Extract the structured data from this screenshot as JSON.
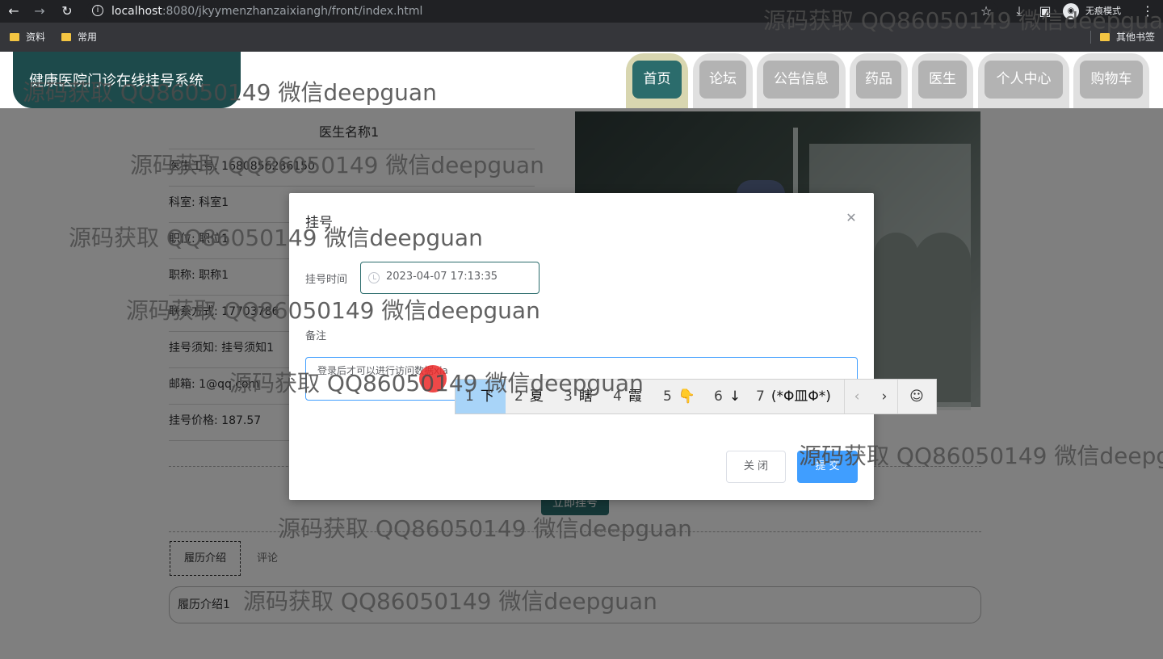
{
  "browser": {
    "url_host": "localhost",
    "url_path": ":8080/jkyymenzhanzaixiangh/front/index.html",
    "incognito_label": "无痕模式",
    "bookmarks": [
      "资料",
      "常用"
    ],
    "other_bookmarks": "其他书签"
  },
  "site": {
    "title": "健康医院门诊在线挂号系统",
    "nav": [
      {
        "label": "首页",
        "active": true
      },
      {
        "label": "论坛",
        "active": false
      },
      {
        "label": "公告信息",
        "active": false
      },
      {
        "label": "药品",
        "active": false
      },
      {
        "label": "医生",
        "active": false
      },
      {
        "label": "个人中心",
        "active": false
      },
      {
        "label": "购物车",
        "active": false
      }
    ]
  },
  "doctor": {
    "name": "医生名称1",
    "fields": [
      "医生工号: 1680856286150",
      "科室: 科室1",
      "职位: 职位1",
      "职称: 职称1",
      "联系方式: 17703786",
      "挂号须知: 挂号须知1",
      "邮箱: 1@qq.com",
      "挂号价格: 187.57"
    ],
    "book_button": "立即挂号",
    "tabs": [
      "履历介绍",
      "评论"
    ],
    "resume": "履历介绍1"
  },
  "dialog": {
    "title": "挂号",
    "time_label": "挂号时间",
    "time_value": "2023-04-07 17:13:35",
    "remark_label": "备注",
    "remark_text": "登录后才可以进行访问数据xia",
    "close_button": "关 闭",
    "submit_button": "提 交"
  },
  "ime": {
    "candidates": [
      {
        "num": "1",
        "text": "下"
      },
      {
        "num": "2",
        "text": "夏"
      },
      {
        "num": "3",
        "text": "瞎"
      },
      {
        "num": "4",
        "text": "霞"
      },
      {
        "num": "5",
        "text": "👇"
      },
      {
        "num": "6",
        "text": "↓"
      },
      {
        "num": "7",
        "text": "(*Φ皿Φ*)"
      }
    ],
    "prev": "‹",
    "next": "›",
    "emoji": "☺"
  },
  "watermark": "源码获取 QQ86050149 微信deepguan"
}
